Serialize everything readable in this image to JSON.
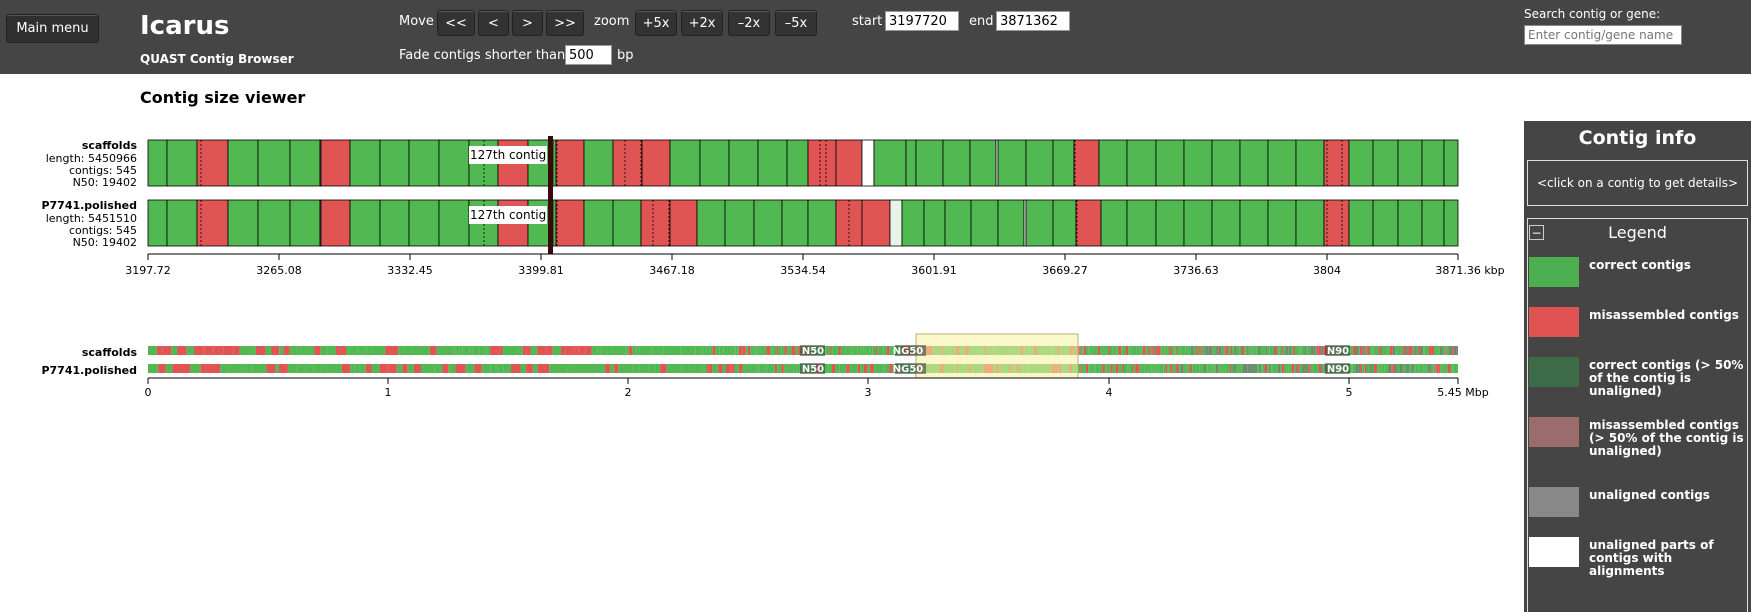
{
  "header": {
    "main_menu": "Main menu",
    "title": "Icarus",
    "subtitle": "QUAST Contig Browser",
    "move_label": "Move",
    "move_buttons": [
      "<<",
      "<",
      ">",
      ">>"
    ],
    "zoom_label": "zoom",
    "zoom_buttons": [
      "+5x",
      "+2x",
      "–2x",
      "–5x"
    ],
    "start_label": "start",
    "start_value": "3197720",
    "end_label": "end",
    "end_value": "3871362",
    "fade_label": "Fade contigs shorter than",
    "fade_value": "500",
    "fade_unit": "bp",
    "search_label": "Search contig or gene:",
    "search_placeholder": "Enter contig/gene name"
  },
  "viewer": {
    "title": "Contig size viewer",
    "assemblies": [
      {
        "name": "scaffolds",
        "length": "length: 5450966",
        "contigs": "contigs: 545",
        "n50": "N50: 19402"
      },
      {
        "name": "P7741.polished",
        "length": "length: 5451510",
        "contigs": "contigs: 545",
        "n50": "N50: 19402"
      }
    ],
    "tooltip": "127th contig",
    "axis_ticks": [
      "3197.72",
      "3265.08",
      "3332.45",
      "3399.81",
      "3467.18",
      "3534.54",
      "3601.91",
      "3669.27",
      "3736.63",
      "3804",
      "3871.36 kbp"
    ],
    "overview_ticks": [
      "0",
      "1",
      "2",
      "3",
      "4",
      "5",
      "5.45 Mbp"
    ],
    "overview_markers": [
      "N50",
      "NG50",
      "N90"
    ]
  },
  "info": {
    "title": "Contig info",
    "hint": "<click on a contig to get details>"
  },
  "legend": {
    "title": "Legend",
    "collapse": "−",
    "items": [
      {
        "label": "correct contigs",
        "color": "#4caf50"
      },
      {
        "label": "misassembled contigs",
        "color": "#e15252"
      },
      {
        "label": "correct contigs (> 50% of the contig is unaligned)",
        "color": "#3d6b47"
      },
      {
        "label": "misassembled contigs (> 50% of the contig is unaligned)",
        "color": "#9c6b6b"
      },
      {
        "label": "unaligned contigs",
        "color": "#888888"
      },
      {
        "label": "unaligned parts of contigs with alignments",
        "color": "#ffffff"
      }
    ]
  },
  "colors": {
    "correct": "#52b852",
    "misassembled": "#e05454",
    "header_bg": "#454545"
  }
}
